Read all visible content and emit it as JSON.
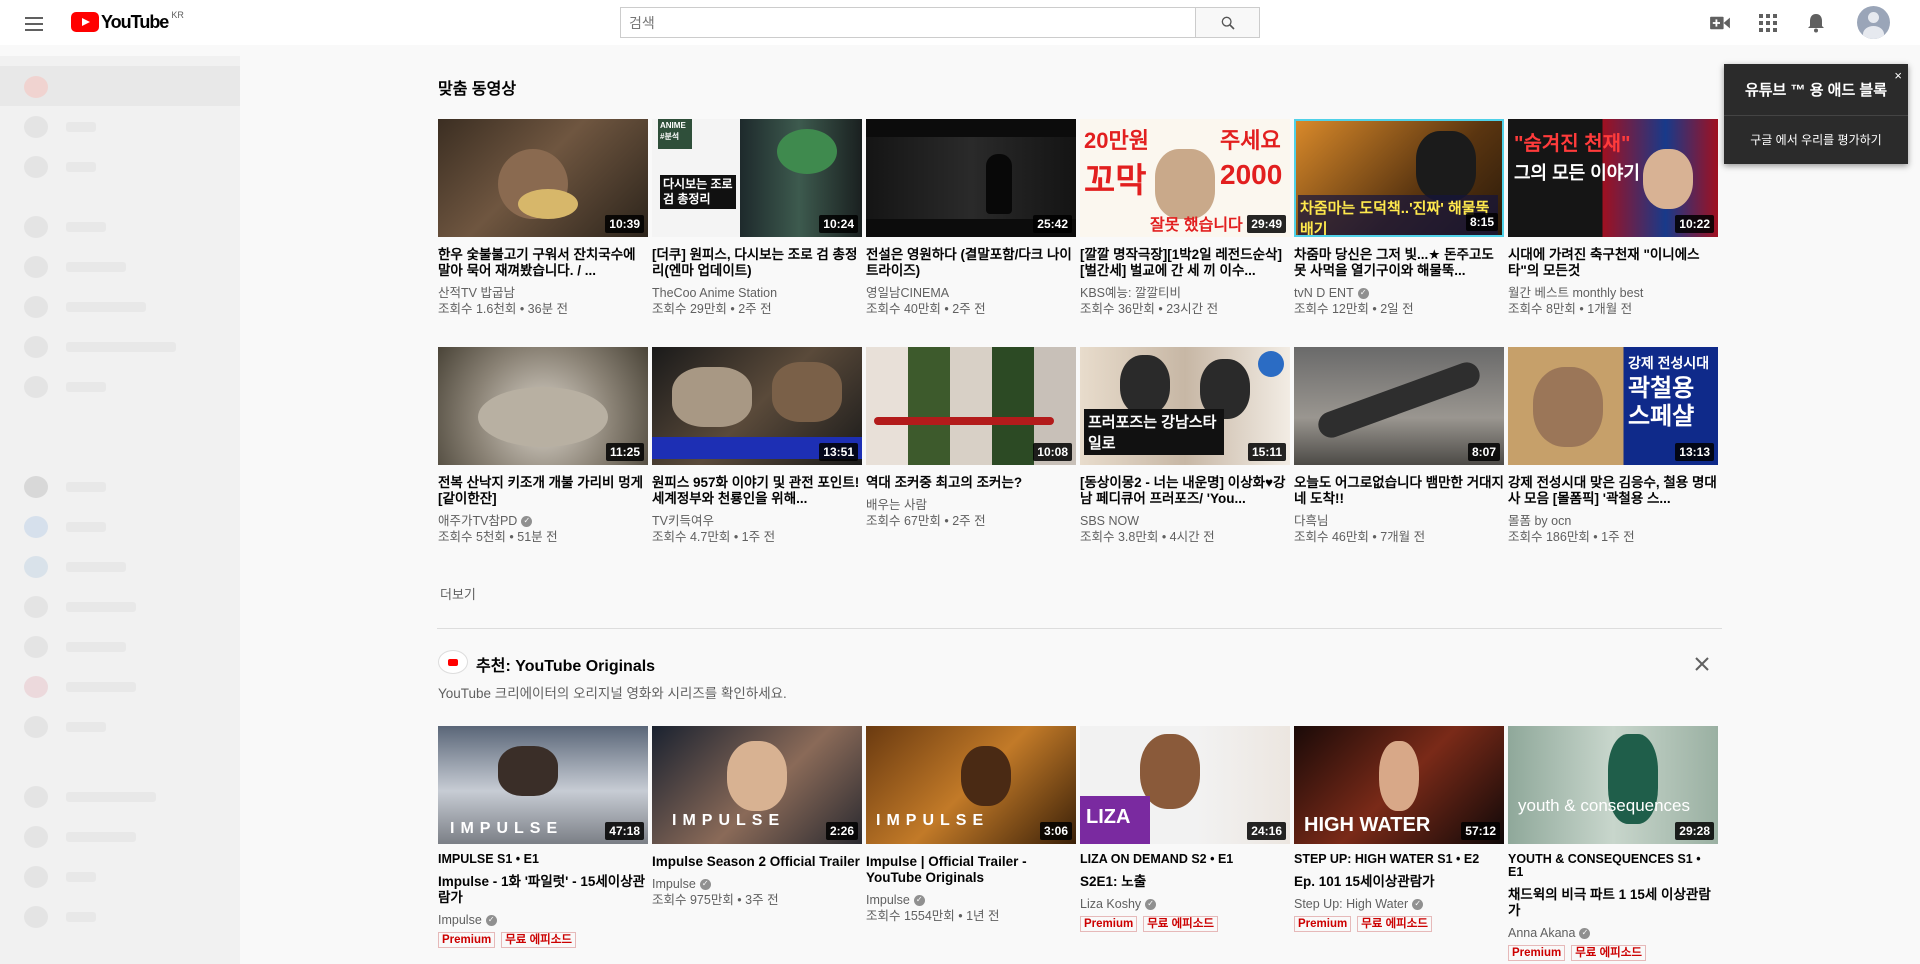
{
  "header": {
    "logo_text": "YouTube",
    "logo_region": "KR",
    "search_placeholder": "검색"
  },
  "section1": {
    "title": "맞춤 동영상",
    "more_label": "더보기",
    "videos": [
      {
        "title": "한우 숯불불고기 구워서 잔치국수에 말아 묵어 재껴봤습니다. / ...",
        "channel": "산적TV 밥굽남",
        "meta": "조회수 1.6천회 • 36분 전",
        "duration": "10:39"
      },
      {
        "title": "[더쿠] 원피스, 다시보는 조로 검 총정리(엔마 업데이트)",
        "channel": "TheCoo Anime Station",
        "meta": "조회수 29만회 • 2주 전",
        "duration": "10:24"
      },
      {
        "title": "전설은 영원하다 (결말포함/다크 나이트라이즈)",
        "channel": "영일남CINEMA",
        "meta": "조회수 40만회 • 2주 전",
        "duration": "25:42"
      },
      {
        "title": "[깔깔 명작극장][1박2일 레전드순삭][벌간세] 벌교에 간 세 끼 이수...",
        "channel": "KBS예능: 깔깔티비",
        "meta": "조회수 36만회 • 23시간 전",
        "duration": "29:49"
      },
      {
        "title": "차줌마 당신은 그저 빛...★ 돈주고도 못 사먹을 열기구이와 해물뚝...",
        "channel": "tvN D ENT",
        "verified": true,
        "meta": "조회수 12만회 • 2일 전",
        "duration": "8:15"
      },
      {
        "title": "시대에 가려진 축구천재 \"이니에스타\"의 모든것",
        "channel": "월간 베스트 monthly best",
        "meta": "조회수 8만회 • 1개월 전",
        "duration": "10:22"
      },
      {
        "title": "전복 산낙지 키조개 개불 가리비 멍게 [같이한잔]",
        "channel": "애주가TV참PD",
        "verified": true,
        "meta": "조회수 5천회 • 51분 전",
        "duration": "11:25"
      },
      {
        "title": "원피스 957화 이야기 및 관전 포인트! 세계정부와 천룡인을 위해...",
        "channel": "TV키득여우",
        "meta": "조회수 4.7만회 • 1주 전",
        "duration": "13:51"
      },
      {
        "title": "역대 조커중 최고의 조커는?",
        "channel": "배우는 사람",
        "meta": "조회수 67만회 • 2주 전",
        "duration": "10:08"
      },
      {
        "title": "[동상이몽2 - 너는 내운명] 이상화♥강남 페디큐어 프러포즈/ 'You...",
        "channel": "SBS NOW",
        "meta": "조회수 3.8만회 • 4시간 전",
        "duration": "15:11"
      },
      {
        "title": "오늘도 어그로없습니다 뱀만한 거대지네 도착!!",
        "channel": "다흑님",
        "meta": "조회수 46만회 • 7개월 전",
        "duration": "8:07"
      },
      {
        "title": "강제 전성시대 맞은 김응수, 철용 명대사 모음 [몰폼픽] '곽철용 스...",
        "channel": "몰폼 by ocn",
        "meta": "조회수 186만회 • 1주 전",
        "duration": "13:13"
      }
    ]
  },
  "thumb_texts": {
    "t2_line1": "ANIME",
    "t2_line2": "#분석",
    "t2_main": "다시보는 조로 검 총정리",
    "t4_top": "20만원",
    "t4_side": "주세요",
    "t4_big": "꼬막",
    "t4_num": "2000",
    "t4_bottom": "잘못 했습니다",
    "t5_main": "차줌마는 도덕책..'진짜' 해물뚝배기",
    "t6_top": "\"숨겨진 천재\"",
    "t6_sub": "그의 모든 이야기",
    "t10_main": "프러포즈는 강남스타일로",
    "t12_top": "강제 전성시대",
    "t12_main": "곽철용 스페샬"
  },
  "section2": {
    "title": "추천: YouTube Originals",
    "description": "YouTube 크리에이터의 오리지널 영화와 시리즈를 확인하세요.",
    "items": [
      {
        "ep": "IMPULSE  S1 • E1",
        "title": "Impulse - 1화 '파일럿' - 15세이상관람가",
        "channel": "Impulse",
        "meta": "",
        "duration": "47:18",
        "premium": "Premium",
        "free": "무료 에피소드",
        "thumb_label": "IMPULSE"
      },
      {
        "ep": "",
        "title": "Impulse Season 2 Official Trailer",
        "channel": "Impulse",
        "meta": "조회수 975만회 • 3주 전",
        "duration": "2:26",
        "thumb_label": "IMPULSE"
      },
      {
        "ep": "",
        "title": "Impulse | Official Trailer - YouTube Originals",
        "channel": "Impulse",
        "meta": "조회수 1554만회 • 1년 전",
        "duration": "3:06",
        "thumb_label": "IMPULSE"
      },
      {
        "ep": "LIZA ON DEMAND  S2 • E1",
        "title": "S2E1: 노출",
        "channel": "Liza Koshy",
        "meta": "",
        "duration": "24:16",
        "premium": "Premium",
        "free": "무료 에피소드",
        "thumb_label": "LIZA"
      },
      {
        "ep": "STEP UP: HIGH WATER  S1 • E2",
        "title": "Ep. 101 15세이상관람가",
        "channel": "Step Up: High Water",
        "meta": "",
        "duration": "57:12",
        "premium": "Premium",
        "free": "무료 에피소드",
        "thumb_label": "HIGH WATER"
      },
      {
        "ep": "YOUTH & CONSEQUENCES  S1 • E1",
        "title": "채드윅의 비극 파트 1 15세 이상관람가",
        "channel": "Anna Akana",
        "meta": "",
        "duration": "29:28",
        "premium": "Premium",
        "free": "무료 에피소드",
        "thumb_label": "youth & consequences"
      }
    ]
  },
  "popup": {
    "title": "유튜브 ™ 용 애드 블록",
    "link": "구글 에서 우리를 평가하기",
    "close": "×"
  }
}
